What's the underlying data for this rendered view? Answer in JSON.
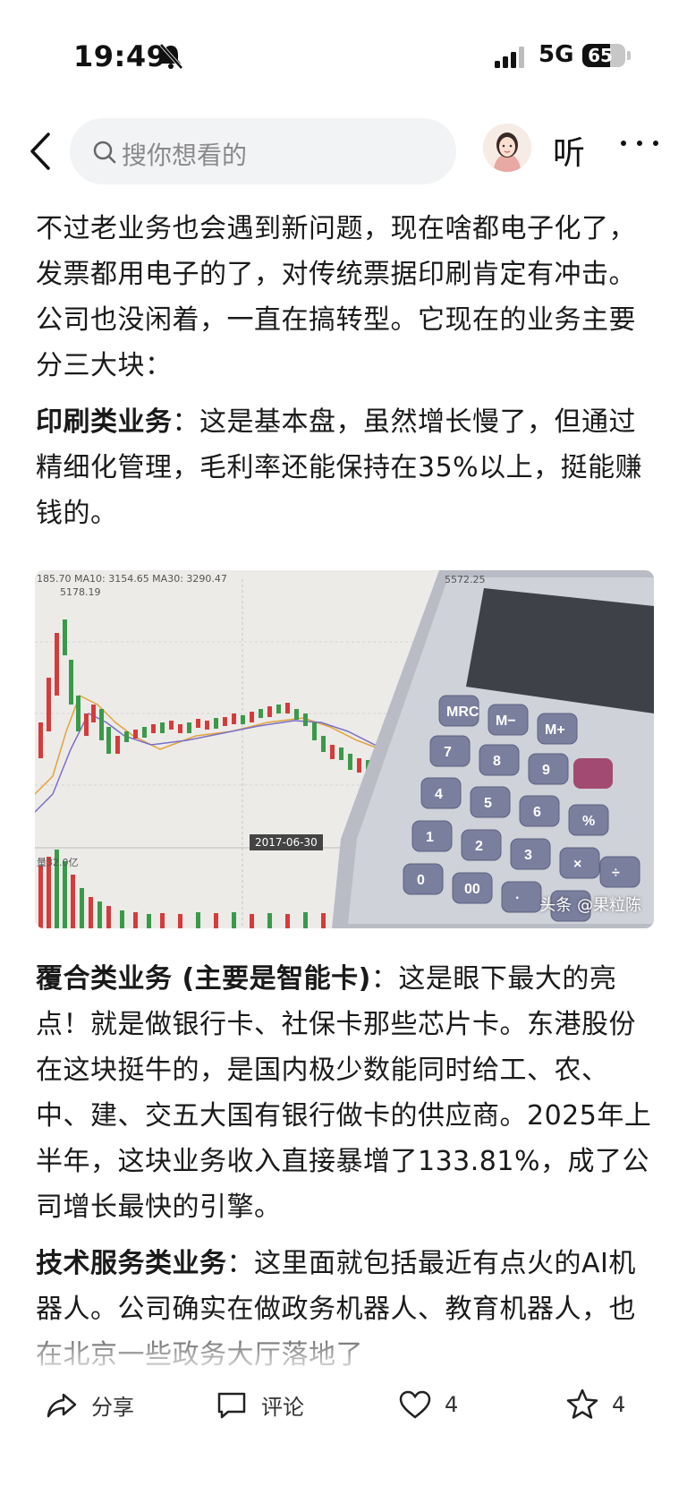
{
  "status_bar": {
    "time": "19:49",
    "network": "5G",
    "battery": "65",
    "battery_level": 0.65
  },
  "nav": {
    "search_placeholder": "搜你想看的",
    "listen_label": "听"
  },
  "article": {
    "para1": "不过老业务也会遇到新问题，现在啥都电子化了，发票都用电子的了，对传统票据印刷肯定有冲击。公司也没闲着，一直在搞转型。它现在的业务主要分三大块：",
    "para2_bold": "印刷类业务",
    "para2_text": "：这是基本盘，虽然增长慢了，但通过精细化管理，毛利率还能保持在35%以上，挺能赚钱的。",
    "image": {
      "chart_top_label": "185.70 MA10: 3154.65 MA30: 3290.47",
      "chart_high": "5178.19",
      "chart_right_top": "5572.25",
      "chart_date": "2017-06-30",
      "chart_vol_label": "量32.0亿",
      "watermark": "头条 @果粒陈"
    },
    "para3_bold": "覆合类业务 (主要是智能卡)",
    "para3_text": "：这是眼下最大的亮点！就是做银行卡、社保卡那些芯片卡。东港股份在这块挺牛的，是国内极少数能同时给工、农、中、建、交五大国有银行做卡的供应商。2025年上半年，这块业务收入直接暴增了133.81%，成了公司增长最快的引擎。",
    "para4_bold": "技术服务类业务",
    "para4_text": "：这里面就包括最近有点火的AI机器人。公司确实在做政务机器人、教育机器人，也在北京一些政务大厅落地了"
  },
  "actions": {
    "share_label": "分享",
    "comment_label": "评论",
    "like_count": "4",
    "favorite_count": "4"
  }
}
